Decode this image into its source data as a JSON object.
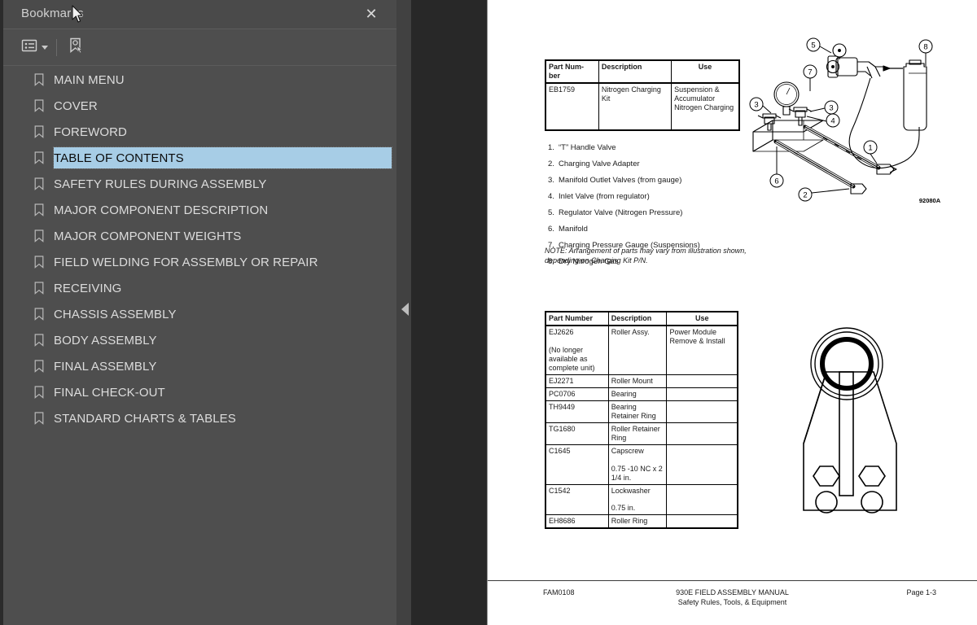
{
  "panel": {
    "title": "Bookmarks",
    "close_label": "✕",
    "toolbar": {
      "options_icon": "list-options-icon",
      "options_caret": "chevron-down-icon",
      "new_bookmark_icon": "new-bookmark-icon"
    },
    "collapse_icon": "collapse-left-arrow-icon",
    "bookmarks": [
      {
        "label": "MAIN MENU",
        "selected": false
      },
      {
        "label": "COVER",
        "selected": false
      },
      {
        "label": "FOREWORD",
        "selected": false
      },
      {
        "label": "TABLE OF CONTENTS",
        "selected": true
      },
      {
        "label": "SAFETY RULES DURING ASSEMBLY",
        "selected": false
      },
      {
        "label": "MAJOR COMPONENT DESCRIPTION",
        "selected": false
      },
      {
        "label": "MAJOR COMPONENT WEIGHTS",
        "selected": false
      },
      {
        "label": "FIELD WELDING FOR ASSEMBLY OR REPAIR",
        "selected": false
      },
      {
        "label": "RECEIVING",
        "selected": false
      },
      {
        "label": "CHASSIS ASSEMBLY",
        "selected": false
      },
      {
        "label": "BODY ASSEMBLY",
        "selected": false
      },
      {
        "label": "FINAL ASSEMBLY",
        "selected": false
      },
      {
        "label": "FINAL CHECK-OUT",
        "selected": false
      },
      {
        "label": "STANDARD CHARTS & TABLES",
        "selected": false
      }
    ]
  },
  "document": {
    "table_kit": {
      "headers": [
        "Part Num-ber",
        "Description",
        "Use"
      ],
      "rows": [
        {
          "part_number": "EB1759",
          "description": "Nitrogen Charging Kit",
          "use": "Suspension & Accumulator Nitrogen Charging"
        }
      ]
    },
    "callouts": [
      {
        "num": "1.",
        "text": "“T” Handle Valve"
      },
      {
        "num": "2.",
        "text": "Charging Valve Adapter"
      },
      {
        "num": "3.",
        "text": "Manifold Outlet Valves (from gauge)"
      },
      {
        "num": "4.",
        "text": "Inlet Valve (from regulator)"
      },
      {
        "num": "5.",
        "text": "Regulator Valve (Nitrogen Pressure)"
      },
      {
        "num": "6.",
        "text": "Manifold"
      },
      {
        "num": "7.",
        "text": "Charging Pressure Gauge (Suspensions)"
      },
      {
        "num": "8.",
        "text": "Dry Nitrogen Gas"
      }
    ],
    "note": "NOTE: Arrangement of parts may vary from illustration shown, depending on Charging Kit P/N.",
    "figure_charging": {
      "name": "nitrogen-charging-kit-diagram",
      "code": "92080A",
      "callout_numbers": [
        "1",
        "2",
        "3",
        "3",
        "4",
        "5",
        "6",
        "7",
        "8"
      ]
    },
    "figure_roller": {
      "name": "roller-assembly-diagram"
    },
    "table_roller": {
      "headers": [
        "Part Number",
        "Description",
        "Use"
      ],
      "rows": [
        {
          "part_number": "EJ2626\n\n(No longer available as complete unit)",
          "description": "Roller Assy.",
          "use": "Power Module Remove & Install"
        },
        {
          "part_number": "EJ2271",
          "description": "Roller Mount",
          "use": ""
        },
        {
          "part_number": "PC0706",
          "description": "Bearing",
          "use": ""
        },
        {
          "part_number": "TH9449",
          "description": "Bearing Retainer Ring",
          "use": ""
        },
        {
          "part_number": "TG1680",
          "description": "Roller Retainer Ring",
          "use": ""
        },
        {
          "part_number": "C1645",
          "description": "Capscrew\n\n0.75 -10 NC x 2 1/4 in.",
          "use": ""
        },
        {
          "part_number": "C1542",
          "description": "Lockwasher\n\n0.75 in.",
          "use": ""
        },
        {
          "part_number": "EH8686",
          "description": "Roller Ring",
          "use": ""
        }
      ]
    },
    "footer": {
      "doc_id": "FAM0108",
      "title": "930E FIELD ASSEMBLY MANUAL",
      "subtitle": "Safety Rules, Tools, & Equipment",
      "page": "Page 1-3"
    }
  },
  "colors": {
    "sidebar_bg": "#4e4e4e",
    "splitter_bg": "#414141",
    "gutter_bg": "#282828",
    "selection": "#a7cde6",
    "page_bg": "#ffffff",
    "text_light": "#dcdcdc"
  }
}
